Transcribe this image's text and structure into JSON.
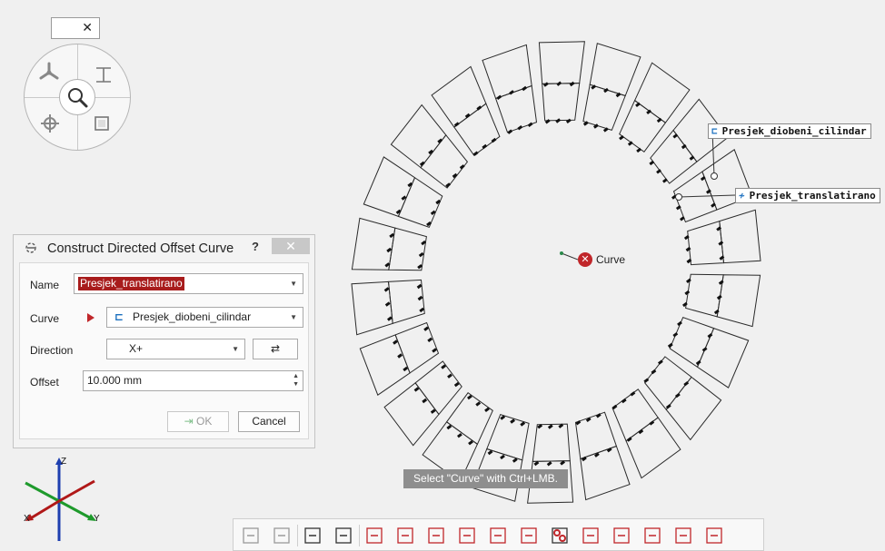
{
  "dialog": {
    "title": "Construct Directed Offset Curve",
    "help_label": "?",
    "close_label": "✕",
    "name_label": "Name",
    "name_value": "Presjek_translatirano",
    "curve_label": "Curve",
    "curve_value": "Presjek_diobeni_cilindar",
    "direction_label": "Direction",
    "direction_value": "X+",
    "swap_label": "⇄",
    "offset_label": "Offset",
    "offset_value": "10.000 mm",
    "ok_label": "OK",
    "cancel_label": "Cancel"
  },
  "viewport": {
    "callout_source": "Presjek_diobeni_cilindar",
    "callout_result": "Presjek_translatirano",
    "error_label": "Curve",
    "hint": "Select \"Curve\" with Ctrl+LMB."
  },
  "compass": {
    "close_label": "✕"
  },
  "triad": {
    "x_label": "X",
    "y_label": "Y",
    "z_label": "Z"
  },
  "colors": {
    "accent_red": "#c0262a",
    "selection_red": "#a81c1c",
    "hint_bg": "#8e8e8e",
    "axis_x": "#b01818",
    "axis_y": "#1e9a2c",
    "axis_z": "#1e3fb0"
  },
  "toolbar": {
    "icons": [
      "view-normal-icon",
      "view-section-icon",
      "display-mode-icon",
      "mirror-icon",
      "plane-icon",
      "offset-plane-icon",
      "point-on-curve-icon",
      "square-icon",
      "inset-icon",
      "angle-icon",
      "link-icon",
      "grid-icon",
      "frame-icon",
      "check-icon",
      "delete-icon",
      "transform-icon"
    ]
  }
}
